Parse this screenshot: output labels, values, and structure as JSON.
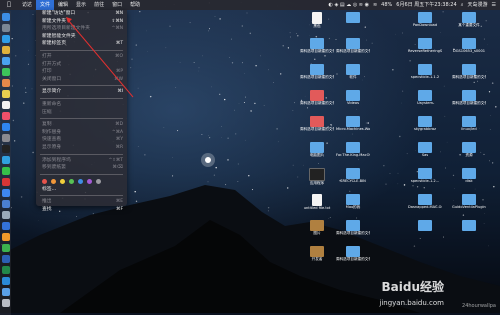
{
  "menubar": {
    "apple_icon": "apple-icon",
    "items": [
      "访达",
      "文件",
      "编辑",
      "显示",
      "前往",
      "窗口",
      "帮助"
    ],
    "active_index": 1,
    "datetime": "6月6日 周五下午23:38:24",
    "battery": "48%",
    "right_text": "天岛漫游"
  },
  "file_menu": {
    "items": [
      {
        "label": "新建\"访达\"窗口",
        "shortcut": "⌘N",
        "enabled": true
      },
      {
        "label": "新建文件夹",
        "shortcut": "⇧⌘N",
        "enabled": true
      },
      {
        "label": "用所选项目新建文件夹",
        "shortcut": "^⌘N",
        "enabled": false
      },
      {
        "label": "新建智能文件夹",
        "shortcut": "",
        "enabled": true
      },
      {
        "label": "新建标签页",
        "shortcut": "⌘T",
        "enabled": true
      },
      {
        "label": "打开",
        "shortcut": "⌘O",
        "enabled": false
      },
      {
        "label": "打开方式",
        "shortcut": "",
        "enabled": false
      },
      {
        "label": "打印",
        "shortcut": "⌘P",
        "enabled": false
      },
      {
        "label": "关闭窗口",
        "shortcut": "⌘W",
        "enabled": false
      },
      {
        "label": "显示简介",
        "shortcut": "⌘I",
        "enabled": true
      },
      {
        "label": "重新命名",
        "shortcut": "",
        "enabled": false
      },
      {
        "label": "压缩",
        "shortcut": "",
        "enabled": false
      },
      {
        "label": "复制",
        "shortcut": "⌘D",
        "enabled": false
      },
      {
        "label": "制作替身",
        "shortcut": "^⌘A",
        "enabled": false
      },
      {
        "label": "快速查看",
        "shortcut": "⌘Y",
        "enabled": false
      },
      {
        "label": "显示原身",
        "shortcut": "⌘R",
        "enabled": false
      },
      {
        "label": "添加到程序坞",
        "shortcut": "^⇧⌘T",
        "enabled": false
      },
      {
        "label": "移到废纸篓",
        "shortcut": "⌘⌫",
        "enabled": false
      },
      {
        "label": "推出",
        "shortcut": "⌘E",
        "enabled": false
      },
      {
        "label": "查找",
        "shortcut": "⌘F",
        "enabled": true
      }
    ],
    "tag_colors": [
      "#e5534b",
      "#f0963a",
      "#f2cf3c",
      "#58c255",
      "#3f8de3",
      "#a45ad6",
      "#9a9aa0"
    ],
    "tags_label": "标签..."
  },
  "desktop": {
    "columns": [
      [
        {
          "label": "黑色",
          "kind": "file"
        },
        {
          "label": "周科选项目新建的文件夹",
          "kind": "folder"
        },
        {
          "label": "周科选项目新建的文件夹 2",
          "kind": "folder"
        },
        {
          "label": "周科选项目新建的文件夹 3",
          "kind": "folder-red"
        },
        {
          "label": "周科选项目新建的文件夹 4",
          "kind": "folder-red"
        },
        {
          "label": "电脑图片",
          "kind": "folder"
        },
        {
          "label": "应用程序",
          "kind": "term"
        },
        {
          "label": "untitled file.txt",
          "kind": "file"
        },
        {
          "label": "图片",
          "kind": "pic"
        },
        {
          "label": "开发者",
          "kind": "pic"
        }
      ],
      [
        {
          "label": "",
          "kind": "folder"
        },
        {
          "label": "周科选项目新建的文件夹",
          "kind": "folder"
        },
        {
          "label": "软件",
          "kind": "folder"
        },
        {
          "label": "Videos",
          "kind": "folder"
        },
        {
          "label": "Micro.Machines.Worl...VATED",
          "kind": "folder"
        },
        {
          "label": "For.The.King.MacOS...IVATED",
          "kind": "folder"
        },
        {
          "label": "SRECYCLE.BIN",
          "kind": "folder"
        },
        {
          "label": "Mac的我",
          "kind": "folder"
        },
        {
          "label": "周科选项目新建的文件夹",
          "kind": "folder"
        },
        {
          "label": "周科选项目新建的文件夹",
          "kind": "folder"
        }
      ],
      [
        {
          "label": "PanDownload",
          "kind": "folder"
        },
        {
          "label": "ReverseRetheringServer_1.2.0",
          "kind": "folder"
        },
        {
          "label": "specsticle-1.1.2",
          "kind": "folder"
        },
        {
          "label": "Uaystem",
          "kind": "folder"
        },
        {
          "label": "skygrabbraz",
          "kind": "folder"
        },
        {
          "label": "Sas",
          "kind": "folder"
        },
        {
          "label": "specsticle-1.2...",
          "kind": "folder"
        },
        {
          "label": "Dasnapped.MAC.GOC",
          "kind": "folder"
        },
        {
          "label": "",
          "kind": "folder"
        }
      ],
      [
        {
          "label": "某个重要文件",
          "kind": "folder"
        },
        {
          "label": "DGS10653_s0001",
          "kind": "folder"
        },
        {
          "label": "周科选项目新建的文件夹 2",
          "kind": "folder"
        },
        {
          "label": "周科选项目新建的文件夹",
          "kind": "folder"
        },
        {
          "label": "linux/led",
          "kind": "folder"
        },
        {
          "label": "资源",
          "kind": "folder"
        },
        {
          "label": "disk",
          "kind": "folder"
        },
        {
          "label": "GuidoVentilaPlugin...master",
          "kind": "folder"
        },
        {
          "label": "",
          "kind": "folder"
        }
      ]
    ]
  },
  "watermark": {
    "brand": "Baidu经验",
    "url": "jingyan.baidu.com",
    "corner": "24hourwallpa"
  }
}
